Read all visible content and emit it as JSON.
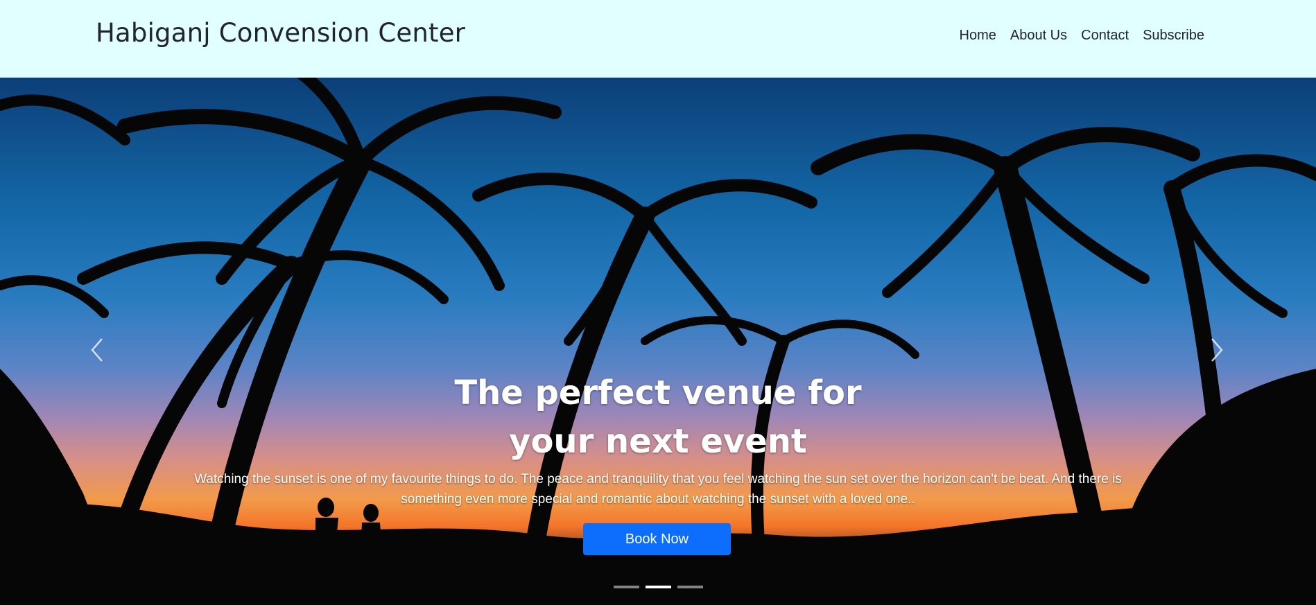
{
  "brand": {
    "name": "Habiganj Convension Center"
  },
  "nav": {
    "items": [
      {
        "label": "Home"
      },
      {
        "label": "About Us"
      },
      {
        "label": "Contact"
      },
      {
        "label": "Subscribe"
      }
    ]
  },
  "hero": {
    "title": "The perfect venue for your next event",
    "description": "Watching the sunset is one of my favourite things to do. The peace and tranquility that you feel watching the sun set over the horizon can't be beat. And there is something even more special and romantic about watching the sunset with a loved one..",
    "button_label": "Book Now",
    "active_slide": 2,
    "slide_count": 3
  },
  "colors": {
    "navbar_bg": "#e0fffe",
    "button_bg": "#0d6efd",
    "text_dark": "#212529"
  },
  "icons": {
    "prev": "chevron-left-icon",
    "next": "chevron-right-icon"
  }
}
